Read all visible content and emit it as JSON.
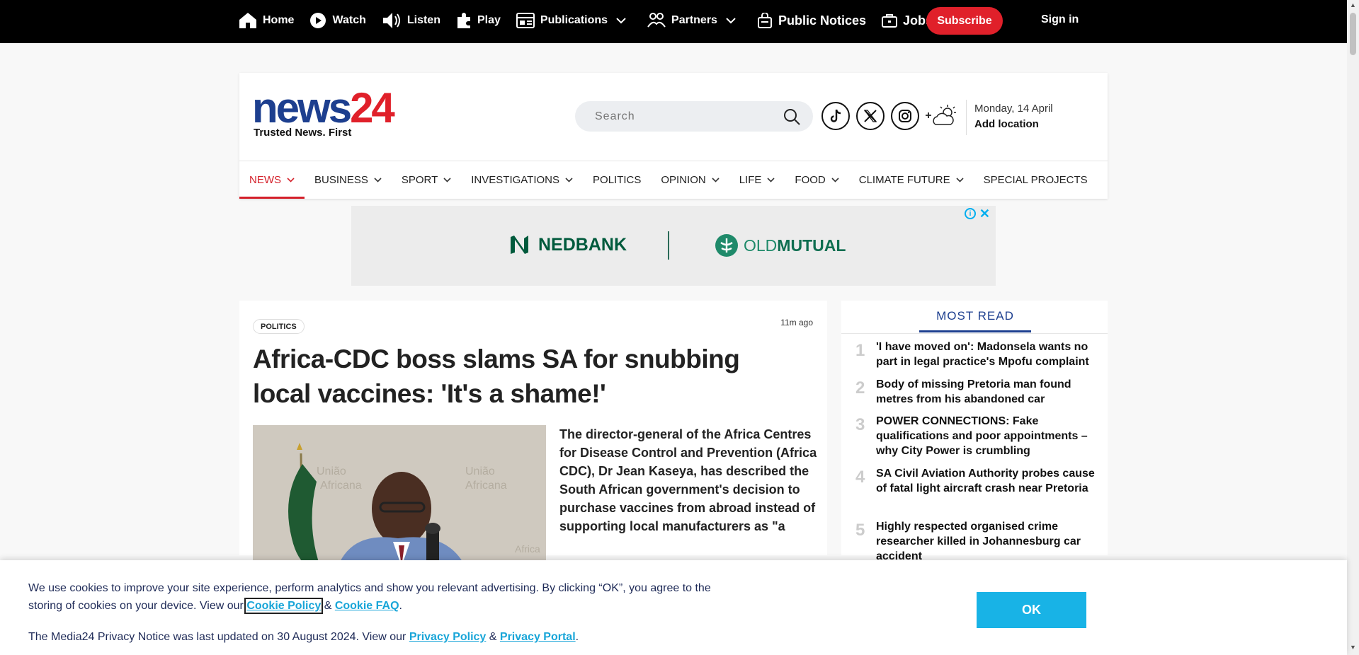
{
  "topnav": {
    "home": "Home",
    "watch": "Watch",
    "listen": "Listen",
    "play": "Play",
    "publications": "Publications",
    "partners": "Partners",
    "public_notices": "Public Notices",
    "jobs": "Jobs",
    "subscribe": "Subscribe",
    "sign_in": "Sign in"
  },
  "header": {
    "logo_part1": "news",
    "logo_part2": "24",
    "tagline": "Trusted News. First",
    "search_placeholder": "Search",
    "date": "Monday, 14 April",
    "add_location": "Add location",
    "social_icons": [
      "tiktok-icon",
      "x-icon",
      "instagram-icon"
    ]
  },
  "mainnav": [
    {
      "label": "NEWS",
      "dropdown": true,
      "active": true
    },
    {
      "label": "BUSINESS",
      "dropdown": true
    },
    {
      "label": "SPORT",
      "dropdown": true
    },
    {
      "label": "INVESTIGATIONS",
      "dropdown": true
    },
    {
      "label": "POLITICS",
      "dropdown": false
    },
    {
      "label": "OPINION",
      "dropdown": true
    },
    {
      "label": "LIFE",
      "dropdown": true
    },
    {
      "label": "FOOD",
      "dropdown": true
    },
    {
      "label": "CLIMATE FUTURE",
      "dropdown": true
    },
    {
      "label": "SPECIAL PROJECTS",
      "dropdown": false
    }
  ],
  "ad": {
    "brand1": "NEDBANK",
    "brand2_light": "OLD",
    "brand2_bold": "MUTUAL"
  },
  "article": {
    "category": "POLITICS",
    "time_ago": "11m ago",
    "headline": "Africa-CDC boss slams SA for snubbing local vaccines: 'It's a shame!'",
    "summary": "The director-general of the Africa Centres for Disease Control and Prevention (Africa CDC), Dr Jean Kaseya, has described the South African government's decision to purchase vaccines from abroad instead of supporting local manufacturers as \"a"
  },
  "most_read": {
    "title": "MOST READ",
    "items": [
      {
        "num": "1",
        "text": "'I have moved on': Madonsela wants no part in legal practice's Mpofu complaint"
      },
      {
        "num": "2",
        "text": "Body of missing Pretoria man found metres from his abandoned car"
      },
      {
        "num": "3",
        "text": "POWER CONNECTIONS: Fake qualifications and poor appointments – why City Power is crumbling"
      },
      {
        "num": "4",
        "text": "SA Civil Aviation Authority probes cause of fatal light aircraft crash near Pretoria"
      },
      {
        "num": "5",
        "text": "Highly respected organised crime researcher killed in Johannesburg car accident"
      }
    ]
  },
  "cookie": {
    "text1": "We use cookies to improve your site experience, perform analytics and show you relevant advertising. By clicking “OK”, you agree to the storing of cookies on your device. View our",
    "cookie_policy": "Cookie Policy",
    "amp": "&",
    "cookie_faq": "Cookie FAQ",
    "period": ".",
    "text2": "The Media24 Privacy Notice was last updated on 30 August 2024. View our",
    "privacy_policy": "Privacy Policy",
    "privacy_portal": "Privacy Portal",
    "ok": "OK"
  },
  "colors": {
    "brand_blue": "#1d3f8f",
    "brand_red": "#e0202a",
    "cookie_accent": "#18b3e6"
  }
}
